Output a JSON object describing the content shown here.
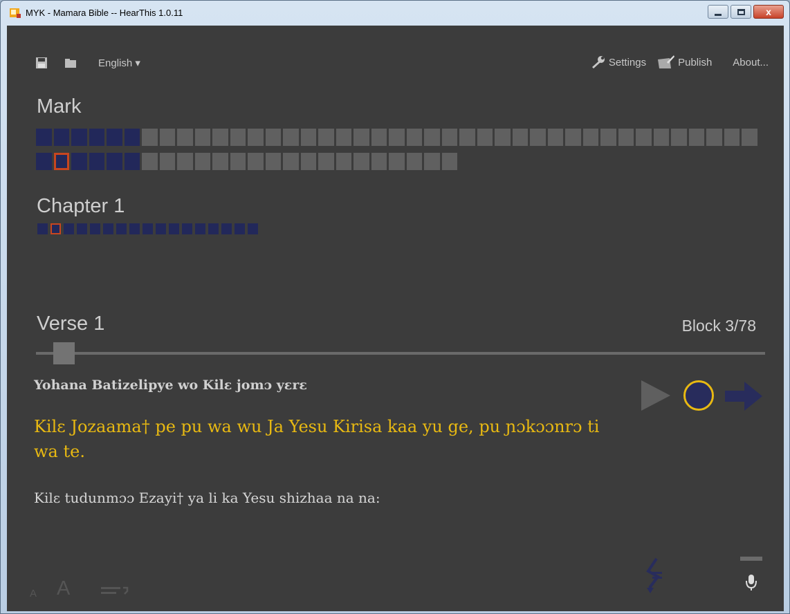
{
  "window": {
    "title": "MYK - Mamara Bible -- HearThis 1.0.11",
    "close_glyph": "x"
  },
  "toolbar": {
    "language": "English ▾",
    "settings": "Settings",
    "publish": "Publish",
    "about": "About..."
  },
  "book": {
    "title": "Mark",
    "chapters_row1": [
      1,
      1,
      1,
      1,
      1,
      1,
      0,
      0,
      0,
      0,
      0,
      0,
      0,
      0,
      0,
      0,
      0,
      0,
      0,
      0,
      0,
      0,
      0,
      0,
      0,
      0,
      0,
      0,
      0,
      0,
      0,
      0,
      0,
      0,
      0,
      0,
      0,
      0,
      0,
      0,
      0
    ],
    "chapters_row2": [
      1,
      2,
      1,
      1,
      1,
      1,
      0,
      0,
      0,
      0,
      0,
      0,
      0,
      0,
      0,
      0,
      0,
      0,
      0,
      0,
      0,
      0,
      0,
      0
    ]
  },
  "chapter": {
    "title": "Chapter 1",
    "verses_count": 17,
    "selected_index": 1
  },
  "verse": {
    "title": "Verse 1",
    "block_label": "Block 3/78",
    "slider_position": 0.03
  },
  "lines": {
    "heading": "Yohana Batizelipye wo Kilɛ jomɔ yɛrɛ",
    "current": "Kilɛ Jozaama† pe pu wa wu Ja Yesu Kirisa kaa yu ge, pu ɲɔkɔɔnrɔ ti wa te.",
    "next": "Kilɛ tudunmɔɔ Ezayi† ya li ka Yesu shizhaa na na:"
  },
  "footer": {
    "font_small": "A",
    "font_large": "A"
  },
  "colors": {
    "background": "#3c3c3c",
    "recorded": "#22285a",
    "unrecorded": "#606060",
    "selected_outline": "#c8461f",
    "current_text": "#e8b912"
  },
  "icons": [
    "app-icon",
    "save-icon",
    "folder-icon",
    "wrench-icon",
    "publish-icon",
    "play-icon",
    "record-icon",
    "next-arrow-icon",
    "text-wrap-icon",
    "split-block-icon",
    "microphone-icon"
  ]
}
